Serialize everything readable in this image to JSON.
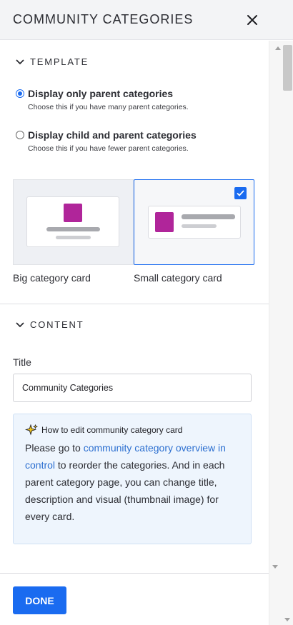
{
  "header": {
    "title": "COMMUNITY CATEGORIES",
    "close_icon": "close-icon"
  },
  "template_section": {
    "label": "TEMPLATE",
    "expanded": true,
    "options": [
      {
        "label": "Display only parent categories",
        "help": "Choose this if you have many parent categories.",
        "selected": true
      },
      {
        "label": "Display child and parent categories",
        "help": "Choose this if you have fewer parent categories.",
        "selected": false
      }
    ],
    "card_styles": [
      {
        "label": "Big category card",
        "selected": false
      },
      {
        "label": "Small category card",
        "selected": true
      }
    ]
  },
  "content_section": {
    "label": "CONTENT",
    "expanded": true,
    "title_field": {
      "label": "Title",
      "value": "Community Categories"
    },
    "info": {
      "icon": "sparkles-icon",
      "title": "How to edit community category card",
      "text_before": "Please go to ",
      "link": "community category overview in control",
      "text_after": " to reorder the categories. And in each parent category page, you can change title, description and visual (thumbnail image) for every card."
    }
  },
  "footer": {
    "done_label": "DONE"
  },
  "colors": {
    "accent": "#1a6bf0",
    "thumbnail": "#b0259a",
    "info_background": "#eef5fd",
    "link": "#2c6fd0"
  }
}
